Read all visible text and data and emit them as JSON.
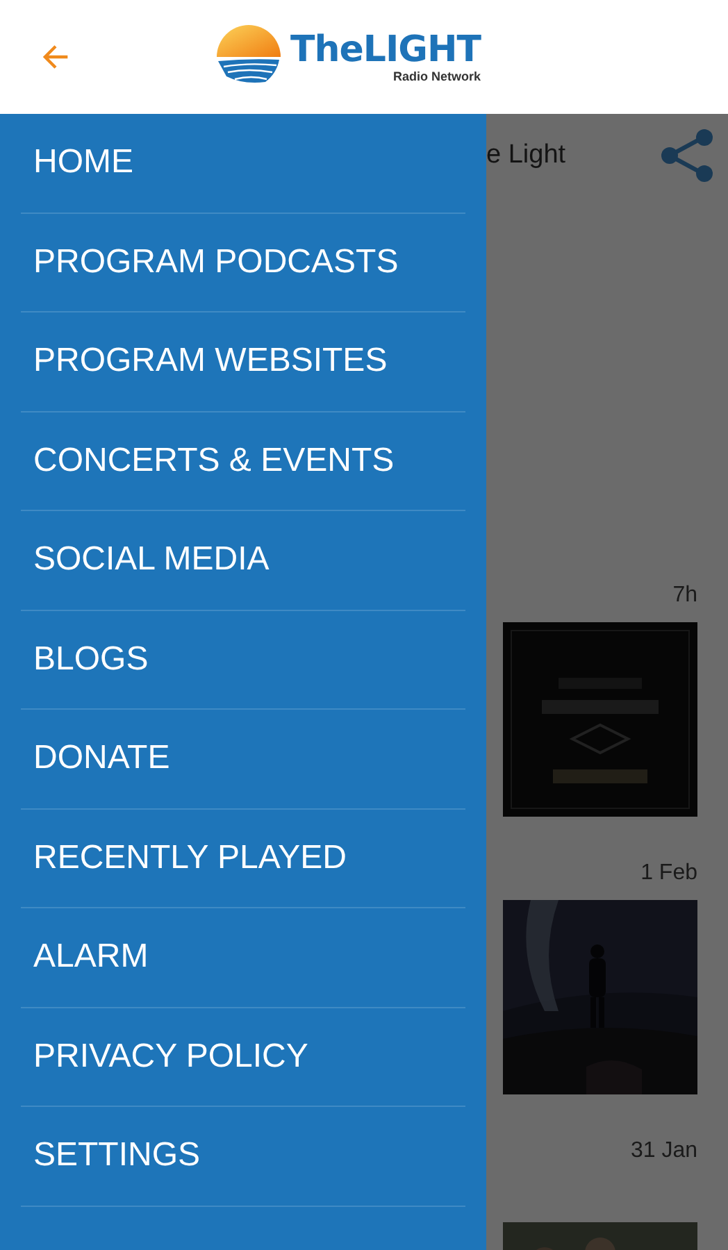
{
  "header": {
    "logo": {
      "title": "TheLIGHT",
      "subtitle": "Radio Network"
    }
  },
  "drawer": {
    "items": [
      {
        "label": "HOME"
      },
      {
        "label": "PROGRAM PODCASTS"
      },
      {
        "label": "PROGRAM WEBSITES"
      },
      {
        "label": "CONCERTS & EVENTS"
      },
      {
        "label": "SOCIAL MEDIA"
      },
      {
        "label": "BLOGS"
      },
      {
        "label": "DONATE"
      },
      {
        "label": "RECENTLY PLAYED"
      },
      {
        "label": "ALARM"
      },
      {
        "label": "PRIVACY POLICY"
      },
      {
        "label": "SETTINGS"
      }
    ]
  },
  "content": {
    "title": "e Light",
    "posts": [
      {
        "time": "7h"
      },
      {
        "time": "1 Feb"
      },
      {
        "time": "31 Jan"
      }
    ]
  }
}
